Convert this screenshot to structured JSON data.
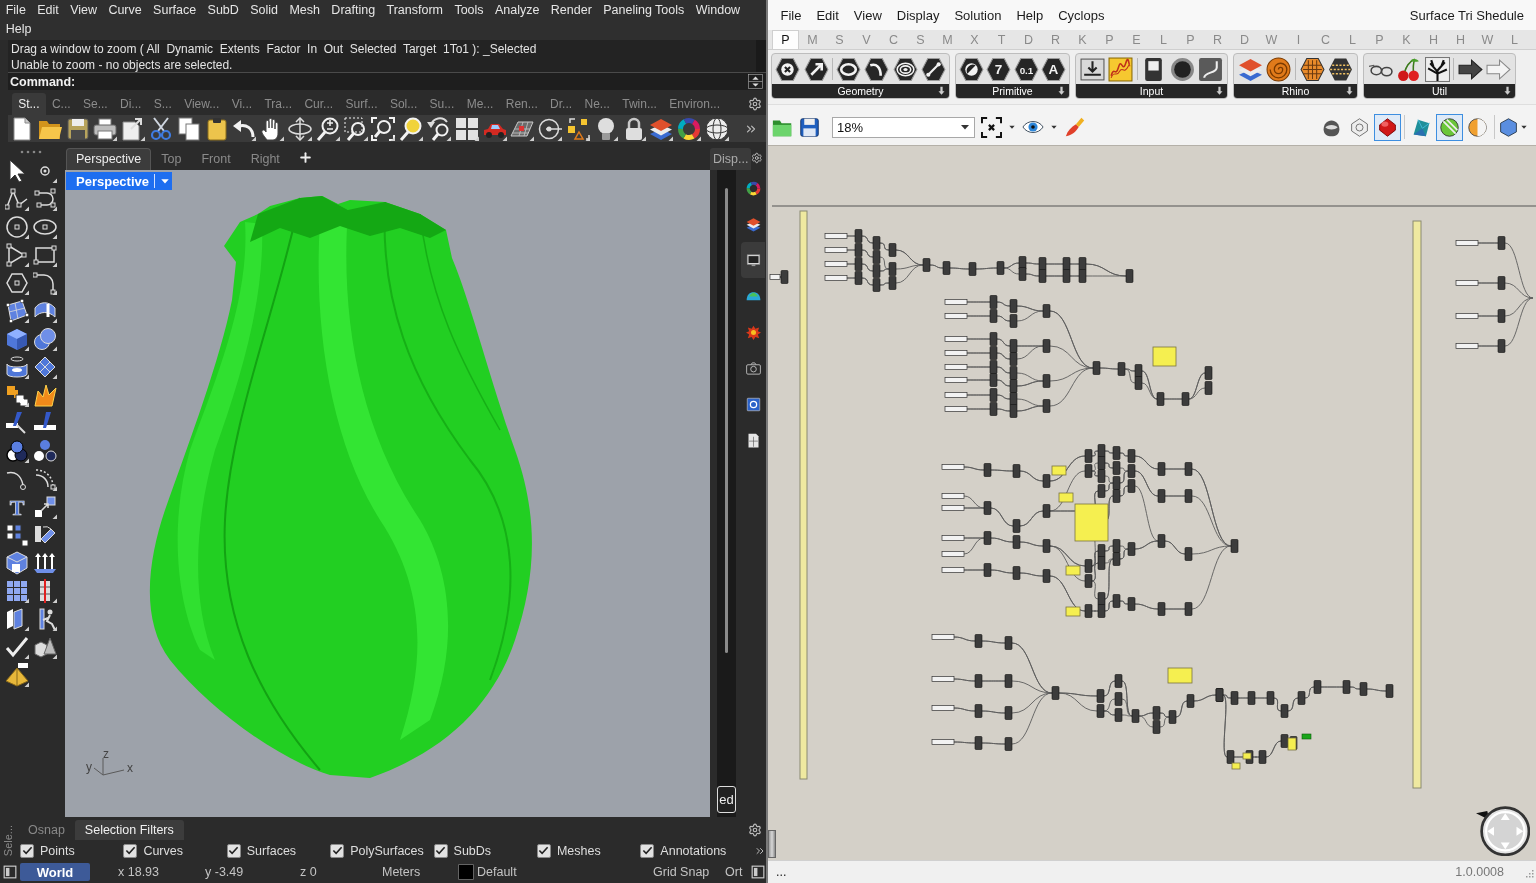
{
  "rhino": {
    "menu_rows": [
      [
        "File",
        "Edit",
        "View",
        "Curve",
        "Surface",
        "SubD",
        "Solid",
        "Mesh",
        "Drafting",
        "Transform",
        "Tools",
        "Analyze",
        "Render",
        "Paneling Tools",
        "Window"
      ],
      [
        "Help"
      ]
    ],
    "command_history": [
      "Drag a window to zoom ( All  Dynamic  Extents  Factor  In  Out  Selected  Target  1To1 ): _Selected",
      "Unable to zoom - no objects are selected."
    ],
    "command_prompt": "Command:",
    "toolbar_tabs": [
      {
        "label": "St...",
        "selected": true
      },
      {
        "label": "C...",
        "selected": false
      },
      {
        "label": "Se...",
        "selected": false
      },
      {
        "label": "Di...",
        "selected": false
      },
      {
        "label": "S...",
        "selected": false
      },
      {
        "label": "View...",
        "selected": false
      },
      {
        "label": "Vi...",
        "selected": false
      },
      {
        "label": "Tra...",
        "selected": false
      },
      {
        "label": "Cur...",
        "selected": false
      },
      {
        "label": "Surf...",
        "selected": false
      },
      {
        "label": "Sol...",
        "selected": false
      },
      {
        "label": "Su...",
        "selected": false
      },
      {
        "label": "Me...",
        "selected": false
      },
      {
        "label": "Ren...",
        "selected": false
      },
      {
        "label": "Dr...",
        "selected": false
      },
      {
        "label": "Ne...",
        "selected": false
      },
      {
        "label": "Twin...",
        "selected": false
      },
      {
        "label": "Environ...",
        "selected": false
      }
    ],
    "text_tool_glyph": "T",
    "viewport_tabs": [
      {
        "label": "Perspective",
        "selected": true
      },
      {
        "label": "Top",
        "selected": false
      },
      {
        "label": "Front",
        "selected": false
      },
      {
        "label": "Right",
        "selected": false
      }
    ],
    "viewport": {
      "label": "Perspective",
      "axis_labels": [
        "y",
        "z",
        "x"
      ]
    },
    "side_panel": {
      "title": "Disp...",
      "tabs": [
        {
          "selected": false
        },
        {
          "selected": false
        },
        {
          "selected": true
        },
        {
          "selected": false
        },
        {
          "selected": false
        },
        {
          "selected": false
        },
        {
          "selected": false
        },
        {
          "selected": false
        }
      ],
      "button": "ed"
    },
    "panel_side_label": "Sele...",
    "panel_tabs": [
      {
        "label": "Osnap",
        "selected": false
      },
      {
        "label": "Selection Filters",
        "selected": true
      }
    ],
    "filters": [
      {
        "label": "Points",
        "checked": true
      },
      {
        "label": "Curves",
        "checked": true
      },
      {
        "label": "Surfaces",
        "checked": true
      },
      {
        "label": "PolySurfaces",
        "checked": true
      },
      {
        "label": "SubDs",
        "checked": true
      },
      {
        "label": "Meshes",
        "checked": true
      },
      {
        "label": "Annotations",
        "checked": true
      }
    ],
    "status_bar": {
      "cplane": "World",
      "x": "x 18.93",
      "y": "y -3.49",
      "z": "z 0",
      "units": "Meters",
      "layer": "Default",
      "grid_snap": "Grid Snap",
      "ortho": "Ort"
    }
  },
  "grasshopper": {
    "menu": [
      "File",
      "Edit",
      "View",
      "Display",
      "Solution",
      "Help",
      "Cyclops"
    ],
    "document_title": "Surface Tri Shedule",
    "tabs": [
      {
        "label": "P",
        "selected": true
      },
      {
        "label": "M",
        "selected": false
      },
      {
        "label": "S",
        "selected": false
      },
      {
        "label": "V",
        "selected": false
      },
      {
        "label": "C",
        "selected": false
      },
      {
        "label": "S",
        "selected": false
      },
      {
        "label": "M",
        "selected": false
      },
      {
        "label": "X",
        "selected": false
      },
      {
        "label": "T",
        "selected": false
      },
      {
        "label": "D",
        "selected": false
      },
      {
        "label": "R",
        "selected": false
      },
      {
        "label": "K",
        "selected": false
      },
      {
        "label": "P",
        "selected": false
      },
      {
        "label": "E",
        "selected": false
      },
      {
        "label": "L",
        "selected": false
      },
      {
        "label": "P",
        "selected": false
      },
      {
        "label": "R",
        "selected": false
      },
      {
        "label": "D",
        "selected": false
      },
      {
        "label": "W",
        "selected": false
      },
      {
        "label": "I",
        "selected": false
      },
      {
        "label": "C",
        "selected": false
      },
      {
        "label": "L",
        "selected": false
      },
      {
        "label": "P",
        "selected": false
      },
      {
        "label": "K",
        "selected": false
      },
      {
        "label": "H",
        "selected": false
      },
      {
        "label": "H",
        "selected": false
      },
      {
        "label": "W",
        "selected": false
      },
      {
        "label": "L",
        "selected": false
      }
    ],
    "ribbon": [
      {
        "label": "Geometry"
      },
      {
        "label": "Primitive",
        "badges": [
          "7",
          "0.1",
          "A"
        ]
      },
      {
        "label": "Input"
      },
      {
        "label": "Rhino"
      },
      {
        "label": "Util"
      }
    ],
    "zoom": "18%",
    "preview_buttons": [
      {
        "on": false
      },
      {
        "on": false
      },
      {
        "on": true
      }
    ],
    "display_buttons": [
      {
        "on": false
      },
      {
        "on": true
      },
      {
        "on": false
      }
    ],
    "status_message": "...",
    "version": "1.0.0008"
  }
}
